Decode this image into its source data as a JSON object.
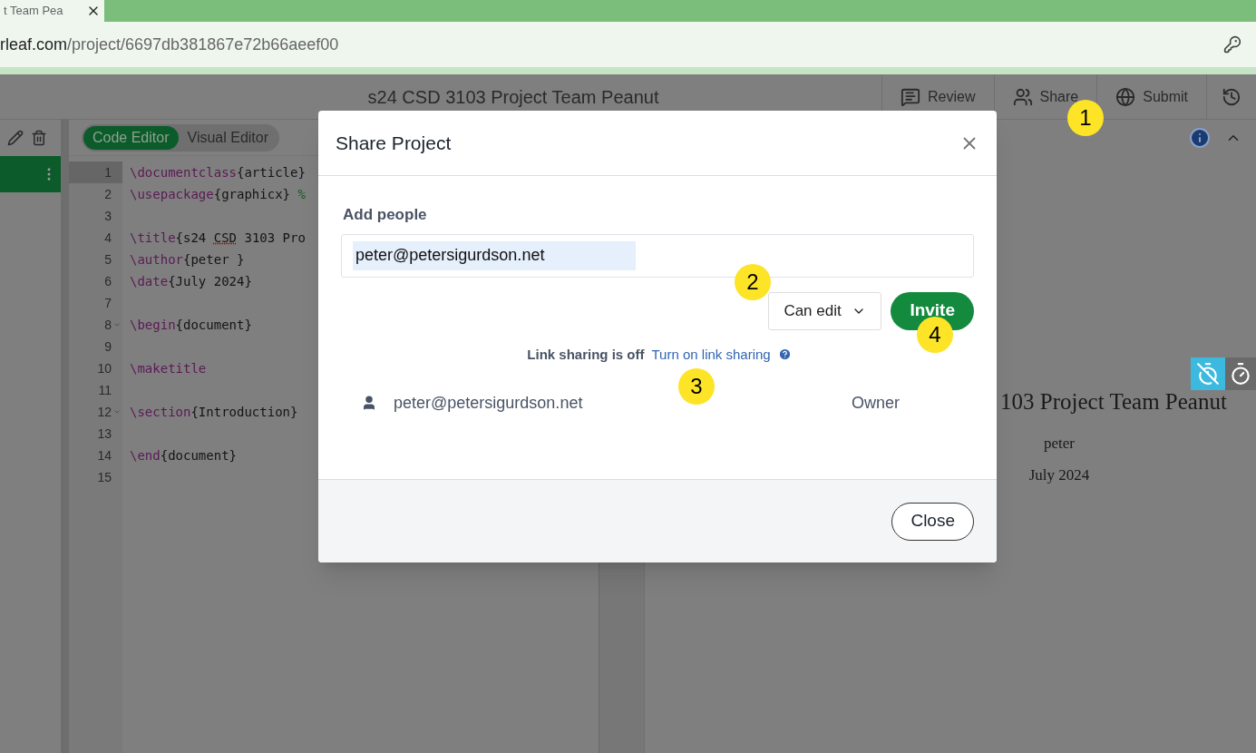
{
  "browser": {
    "tab_title": "t Team Pea",
    "url_domain": "rleaf.com",
    "url_path": "/project/6697db381867e72b66aeef00"
  },
  "toolbar": {
    "project_title": "s24 CSD 3103 Project Team Peanut",
    "actions": [
      {
        "label": "Review",
        "kind": "review"
      },
      {
        "label": "Share",
        "kind": "share"
      },
      {
        "label": "Submit",
        "kind": "submit"
      }
    ]
  },
  "editor_modes": [
    {
      "label": "Code Editor",
      "selected": true
    },
    {
      "label": "Visual Editor",
      "selected": false
    }
  ],
  "code_lines": [
    {
      "number": "1",
      "active": true,
      "foldable": false,
      "tokens": [
        {
          "kind": "command",
          "text": "\\documentclass"
        },
        {
          "kind": "text",
          "text": "{article}"
        }
      ]
    },
    {
      "number": "2",
      "active": false,
      "foldable": false,
      "tokens": [
        {
          "kind": "command",
          "text": "\\usepackage"
        },
        {
          "kind": "text",
          "text": "{graphicx} "
        },
        {
          "kind": "comment",
          "text": "%"
        }
      ]
    },
    {
      "number": "3",
      "active": false,
      "foldable": false
    },
    {
      "number": "4",
      "active": false,
      "foldable": false,
      "tokens": [
        {
          "kind": "command",
          "text": "\\title"
        },
        {
          "kind": "text",
          "text": "{s24 "
        },
        {
          "kind": "misspelled",
          "text": "CSD"
        },
        {
          "kind": "text",
          "text": " 3103 Pro"
        }
      ]
    },
    {
      "number": "5",
      "active": false,
      "foldable": false,
      "tokens": [
        {
          "kind": "command",
          "text": "\\author"
        },
        {
          "kind": "text",
          "text": "{peter }"
        }
      ]
    },
    {
      "number": "6",
      "active": false,
      "foldable": false,
      "tokens": [
        {
          "kind": "command",
          "text": "\\date"
        },
        {
          "kind": "text",
          "text": "{July 2024}"
        }
      ]
    },
    {
      "number": "7",
      "active": false,
      "foldable": false
    },
    {
      "number": "8",
      "active": false,
      "foldable": true,
      "tokens": [
        {
          "kind": "command",
          "text": "\\begin"
        },
        {
          "kind": "text",
          "text": "{document}"
        }
      ]
    },
    {
      "number": "9",
      "active": false,
      "foldable": false
    },
    {
      "number": "10",
      "active": false,
      "foldable": false,
      "tokens": [
        {
          "kind": "command",
          "text": "\\maketitle"
        }
      ]
    },
    {
      "number": "11",
      "active": false,
      "foldable": false
    },
    {
      "number": "12",
      "active": false,
      "foldable": true,
      "tokens": [
        {
          "kind": "command",
          "text": "\\section"
        },
        {
          "kind": "text",
          "text": "{Introduction}"
        }
      ]
    },
    {
      "number": "13",
      "active": false,
      "foldable": false
    },
    {
      "number": "14",
      "active": false,
      "foldable": false,
      "tokens": [
        {
          "kind": "command",
          "text": "\\end"
        },
        {
          "kind": "text",
          "text": "{document}"
        }
      ]
    },
    {
      "number": "15",
      "active": false,
      "foldable": false
    }
  ],
  "pdf": {
    "title": "103 Project Team Peanut",
    "author": "peter",
    "date": "July 2024"
  },
  "dialog": {
    "title": "Share Project",
    "add_people_label": "Add people",
    "email_value": "peter@petersigurdson.net",
    "permission": "Can edit",
    "invite_button": "Invite",
    "link_sharing_status": "Link sharing is off",
    "link_sharing_link": "Turn on link sharing",
    "members": [
      {
        "email": "peter@petersigurdson.net",
        "role": "Owner"
      }
    ],
    "close_button": "Close"
  },
  "callouts": [
    "1",
    "2",
    "3",
    "4"
  ]
}
